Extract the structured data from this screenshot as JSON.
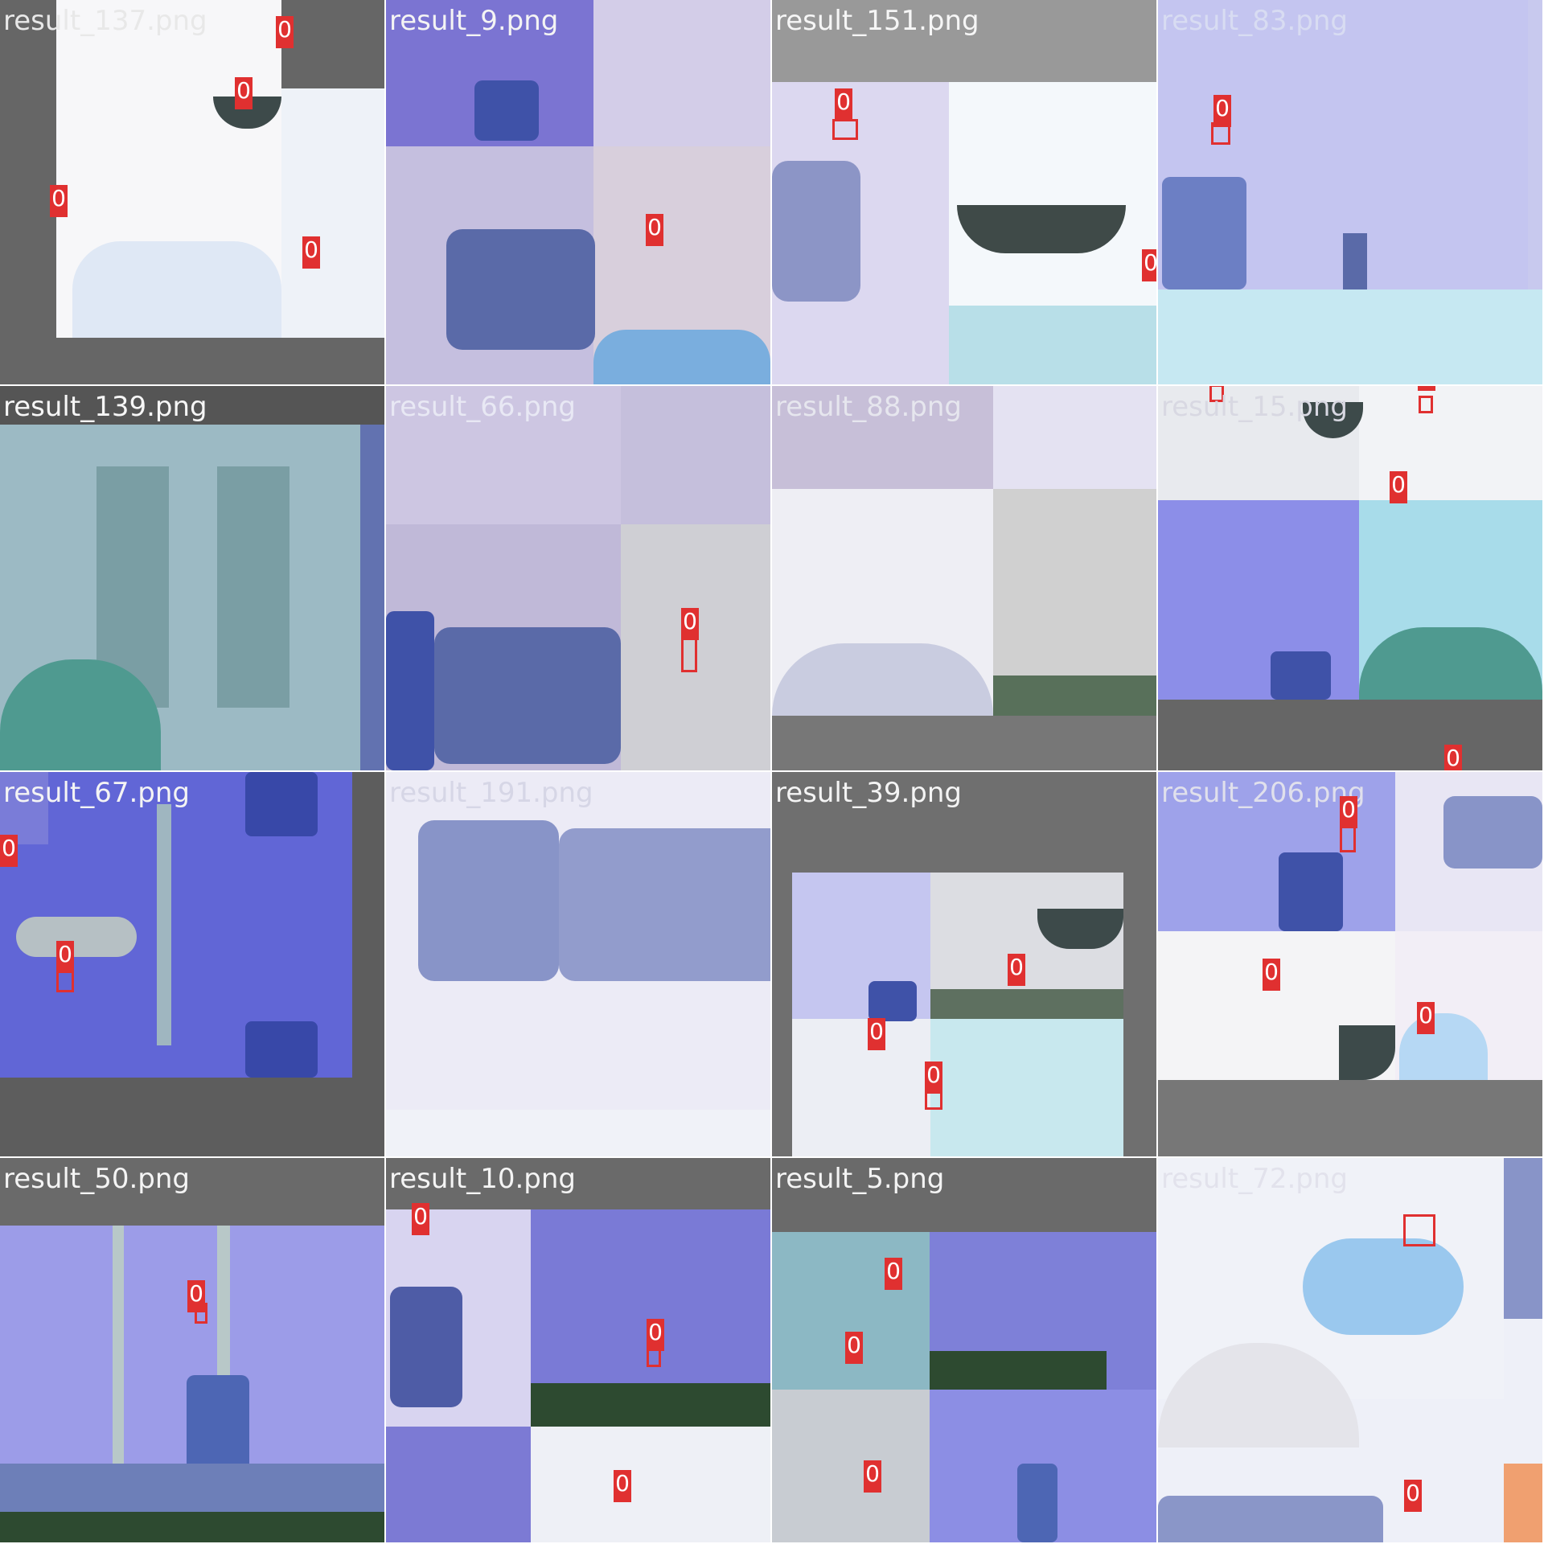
{
  "mosaic": {
    "detection_tag": "0",
    "tiles": [
      {
        "label": "result_137.png",
        "label_color": "#e8e8e8",
        "theme": "white"
      },
      {
        "label": "result_9.png",
        "label_color": "#f4f4f4",
        "theme": "violet"
      },
      {
        "label": "result_151.png",
        "label_color": "#f6f6f6",
        "theme": "grey"
      },
      {
        "label": "result_83.png",
        "label_color": "#d8dcf2",
        "theme": "lavender"
      },
      {
        "label": "result_139.png",
        "label_color": "#f6f6f6",
        "theme": "teal"
      },
      {
        "label": "result_66.png",
        "label_color": "#e8e8f4",
        "theme": "lilac"
      },
      {
        "label": "result_88.png",
        "label_color": "#e6e6ee",
        "theme": "pale"
      },
      {
        "label": "result_15.png",
        "label_color": "#d8d8e2",
        "theme": "mixed"
      },
      {
        "label": "result_67.png",
        "label_color": "#f4f4f4",
        "theme": "indigo"
      },
      {
        "label": "result_191.png",
        "label_color": "#d6d6e6",
        "theme": "pale-lilac"
      },
      {
        "label": "result_39.png",
        "label_color": "#f4f4f4",
        "theme": "dark"
      },
      {
        "label": "result_206.png",
        "label_color": "#e0e0ec",
        "theme": "mixed2"
      },
      {
        "label": "result_50.png",
        "label_color": "#f4f4f4",
        "theme": "forest"
      },
      {
        "label": "result_10.png",
        "label_color": "#f4f4f4",
        "theme": "forest2"
      },
      {
        "label": "result_5.png",
        "label_color": "#f4f4f4",
        "theme": "dark2"
      },
      {
        "label": "result_72.png",
        "label_color": "#e2e2ec",
        "theme": "sky"
      }
    ]
  }
}
